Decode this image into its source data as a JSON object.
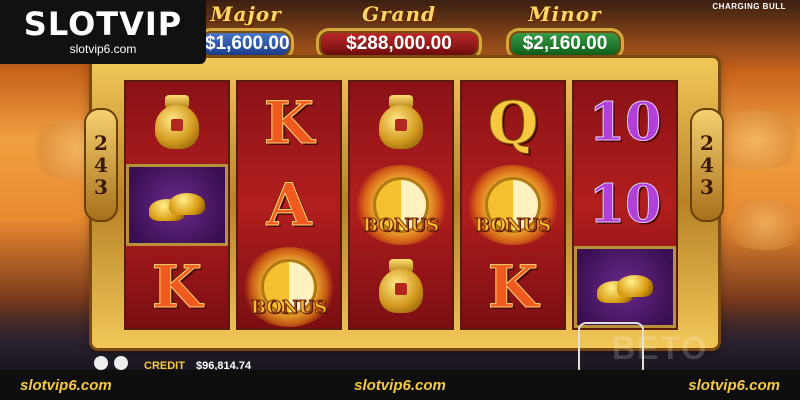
{
  "brand": {
    "logo": "SLOTVIP",
    "domain": "slotvip6.com"
  },
  "game_title": "CHARGING BULL",
  "jackpots": [
    {
      "label": "Major",
      "value": "$1,600.00"
    },
    {
      "label": "Grand",
      "value": "$288,000.00"
    },
    {
      "label": "Minor",
      "value": "$2,160.00"
    }
  ],
  "ways": {
    "left": [
      "2",
      "4",
      "3"
    ],
    "right": [
      "2",
      "4",
      "3"
    ]
  },
  "reels": [
    [
      "gold-urn",
      "gold-ingots",
      "K"
    ],
    [
      "K",
      "A",
      "bonus"
    ],
    [
      "gold-urn",
      "bonus",
      "gold-urn"
    ],
    [
      "Q",
      "bonus",
      "K"
    ],
    [
      "10",
      "10",
      "gold-ingots"
    ]
  ],
  "bonus_text": "BONUS",
  "credit": {
    "label": "CREDIT",
    "value": "$96,814.74"
  },
  "watermark": "BETO",
  "footer": {
    "left": "slotvip6.com",
    "center": "slotvip6.com",
    "right": "slotvip6.com"
  }
}
